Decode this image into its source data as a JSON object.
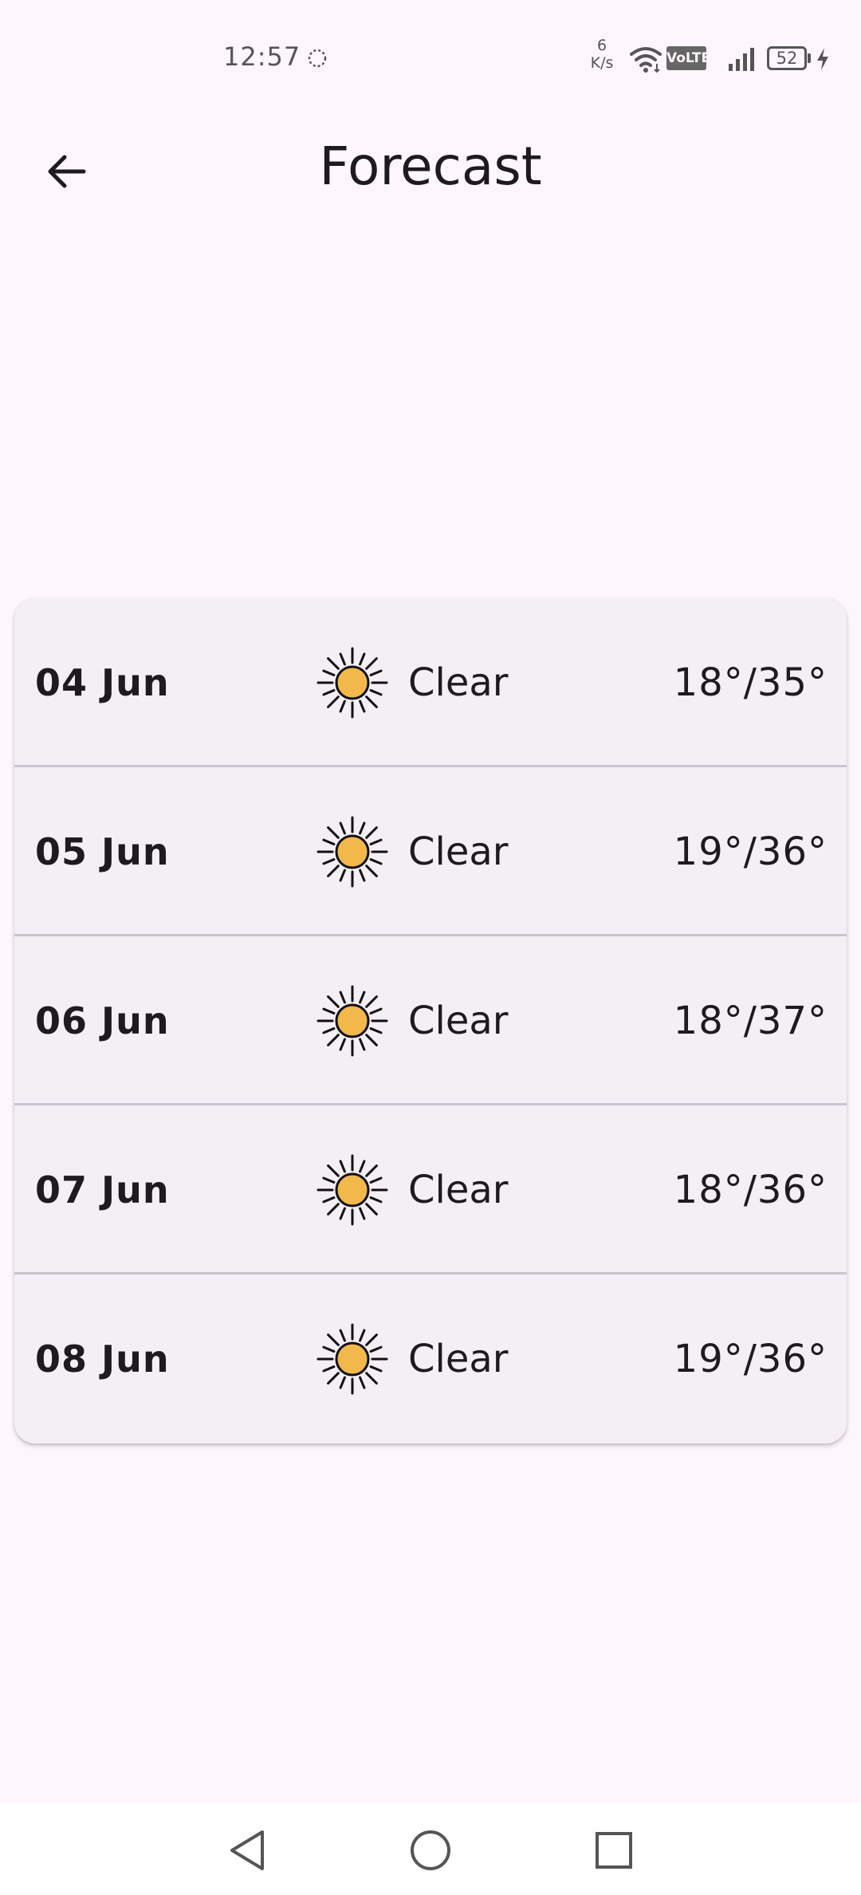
{
  "status_bar": {
    "time": "12:57",
    "net_speed_value": "6",
    "net_speed_unit": "K/s",
    "volte": "VoLTE",
    "battery": "52",
    "icons": [
      "sync-icon",
      "wifi-icon",
      "volte-icon",
      "signal-icon",
      "battery-icon",
      "charging-icon"
    ]
  },
  "app_bar": {
    "title": "Forecast",
    "back_icon": "arrow-back-icon"
  },
  "forecast": {
    "rows": [
      {
        "date": "04 Jun",
        "icon": "sun-icon",
        "condition": "Clear",
        "temps": "18°/35°"
      },
      {
        "date": "05 Jun",
        "icon": "sun-icon",
        "condition": "Clear",
        "temps": "19°/36°"
      },
      {
        "date": "06 Jun",
        "icon": "sun-icon",
        "condition": "Clear",
        "temps": "18°/37°"
      },
      {
        "date": "07 Jun",
        "icon": "sun-icon",
        "condition": "Clear",
        "temps": "18°/36°"
      },
      {
        "date": "08 Jun",
        "icon": "sun-icon",
        "condition": "Clear",
        "temps": "19°/36°"
      }
    ]
  },
  "nav_bar": {
    "icons": [
      "nav-back-icon",
      "nav-home-icon",
      "nav-recents-icon"
    ]
  },
  "colors": {
    "background": "#fdf7fd",
    "card": "#f4eff5",
    "divider": "#cac4cf",
    "sun_fill": "#f2b84b",
    "text": "#1d1b20"
  }
}
